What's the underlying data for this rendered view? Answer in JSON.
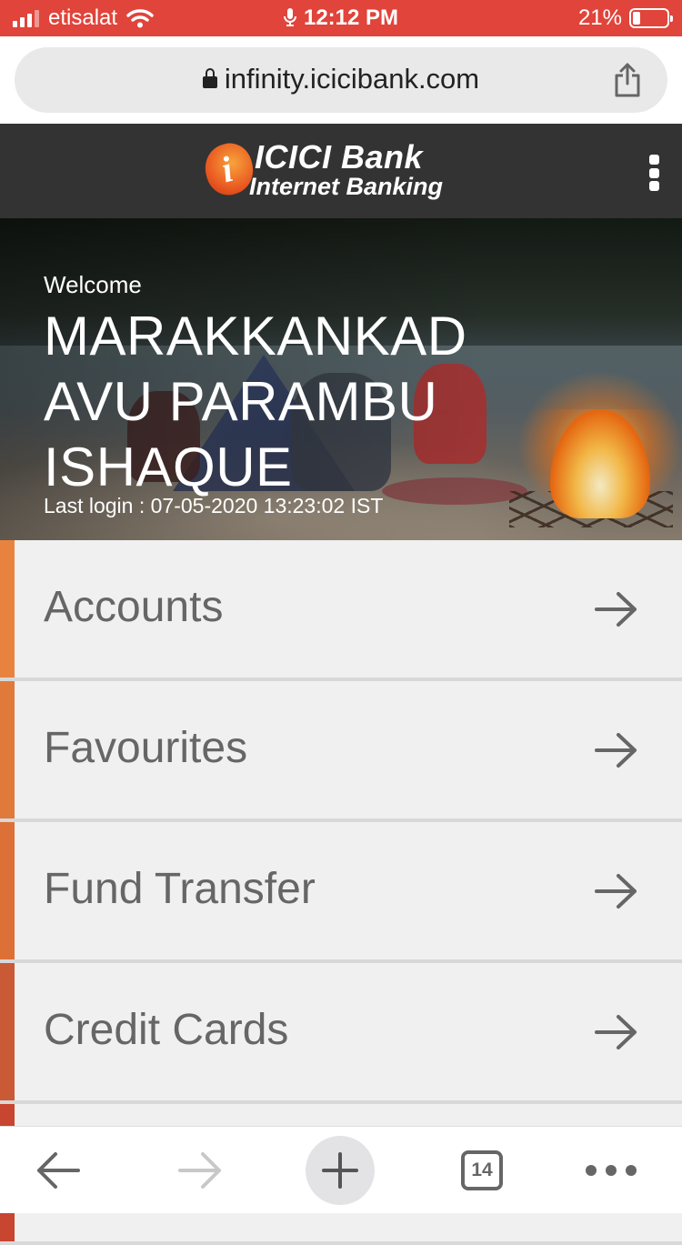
{
  "status_bar": {
    "carrier": "etisalat",
    "time": "12:12 PM",
    "battery": "21%"
  },
  "browser": {
    "url": "infinity.icicibank.com",
    "tab_count": "14"
  },
  "header": {
    "brand": "ICICI Bank",
    "subtitle": "Internet Banking"
  },
  "hero": {
    "welcome": "Welcome",
    "name": "MARAKKANKAD AVU PARAMBU ISHAQUE",
    "last_login": "Last login : 07-05-2020 13:23:02 IST"
  },
  "menu": {
    "items": [
      {
        "label": "Accounts",
        "accent": "#e8833f"
      },
      {
        "label": "Favourites",
        "accent": "#e07a3b"
      },
      {
        "label": "Fund Transfer",
        "accent": "#dc7036"
      },
      {
        "label": "Credit Cards",
        "accent": "#c95a35"
      },
      {
        "label": "",
        "accent": "#c8452f"
      }
    ]
  },
  "colors": {
    "status_bar": "#e0443a",
    "header_bg": "#333333",
    "menu_bg": "#f0f0f0"
  }
}
